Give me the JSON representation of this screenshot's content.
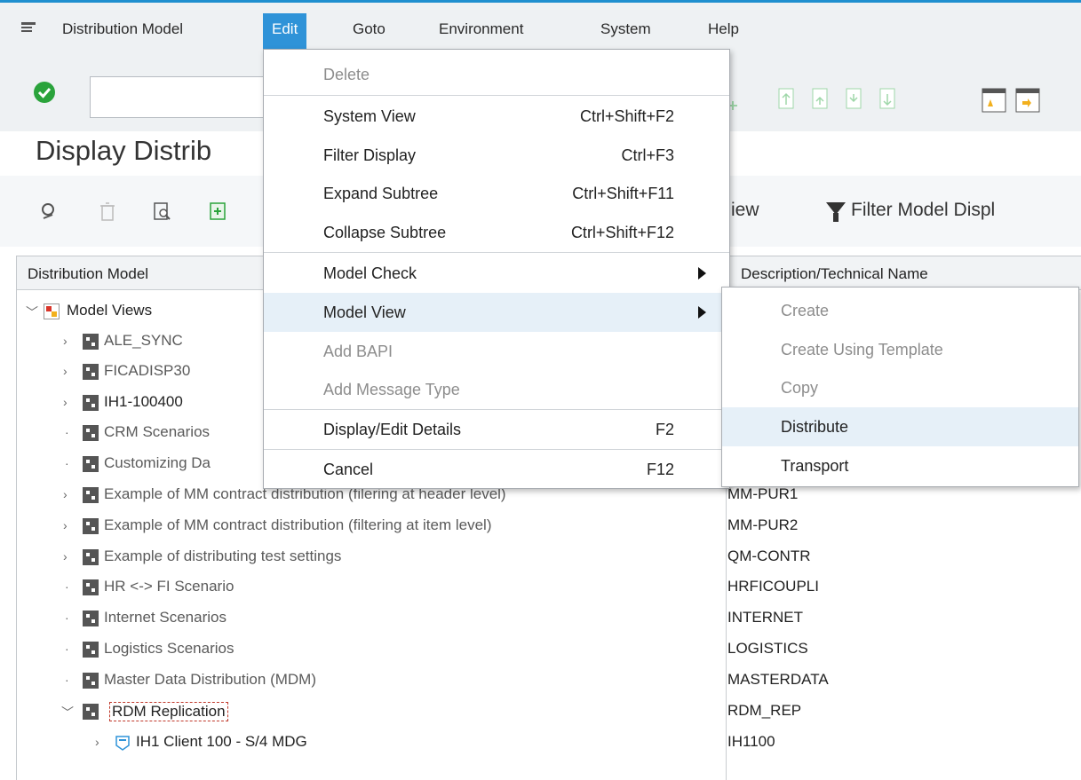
{
  "menubar": {
    "items": [
      "Distribution Model",
      "Edit",
      "Goto",
      "Environment",
      "System",
      "Help"
    ]
  },
  "title": "Display Distrib",
  "apptoolbar": {
    "view_partial": "iew",
    "filter_label": "Filter Model Displ"
  },
  "grid": {
    "col1": "Distribution Model",
    "col2": "Description/Technical Name",
    "rows": [
      {
        "label": "Model Views",
        "tech": ""
      },
      {
        "label": "ALE_SYNC",
        "tech": ""
      },
      {
        "label": "FICADISP30",
        "tech": ""
      },
      {
        "label": "IH1-100400",
        "tech": ""
      },
      {
        "label": "CRM Scenarios",
        "tech": ""
      },
      {
        "label": "Customizing Da",
        "tech": ""
      },
      {
        "label": "Example of MM contract distribution (filering at header level)",
        "tech": "MM-PUR1"
      },
      {
        "label": "Example of MM contract distribution (filtering at item level)",
        "tech": "MM-PUR2"
      },
      {
        "label": "Example of distributing test settings",
        "tech": "QM-CONTR"
      },
      {
        "label": "HR <-> FI Scenario",
        "tech": "HRFICOUPLI"
      },
      {
        "label": "Internet Scenarios",
        "tech": "INTERNET"
      },
      {
        "label": "Logistics Scenarios",
        "tech": "LOGISTICS"
      },
      {
        "label": "Master Data Distribution (MDM)",
        "tech": "MASTERDATA"
      },
      {
        "label": "RDM Replication",
        "tech": "RDM_REP"
      },
      {
        "label": "IH1 Client 100 - S/4 MDG",
        "tech": "IH1100"
      }
    ]
  },
  "edit_menu": {
    "items": [
      {
        "label": "Delete",
        "shortcut": ""
      },
      {
        "label": "System View",
        "shortcut": "Ctrl+Shift+F2"
      },
      {
        "label": "Filter Display",
        "shortcut": "Ctrl+F3"
      },
      {
        "label": "Expand Subtree",
        "shortcut": "Ctrl+Shift+F11"
      },
      {
        "label": "Collapse Subtree",
        "shortcut": "Ctrl+Shift+F12"
      },
      {
        "label": "Model Check",
        "shortcut": ""
      },
      {
        "label": "Model View",
        "shortcut": ""
      },
      {
        "label": "Add BAPI",
        "shortcut": ""
      },
      {
        "label": "Add Message Type",
        "shortcut": ""
      },
      {
        "label": "Display/Edit Details",
        "shortcut": "F2"
      },
      {
        "label": "Cancel",
        "shortcut": "F12"
      }
    ]
  },
  "submenu": {
    "items": [
      "Create",
      "Create Using Template",
      "Copy",
      "Distribute",
      "Transport"
    ]
  },
  "colors": {
    "accent": "#2f93d8",
    "ok_green": "#2aa33b",
    "hover": "#e6f0f8"
  }
}
